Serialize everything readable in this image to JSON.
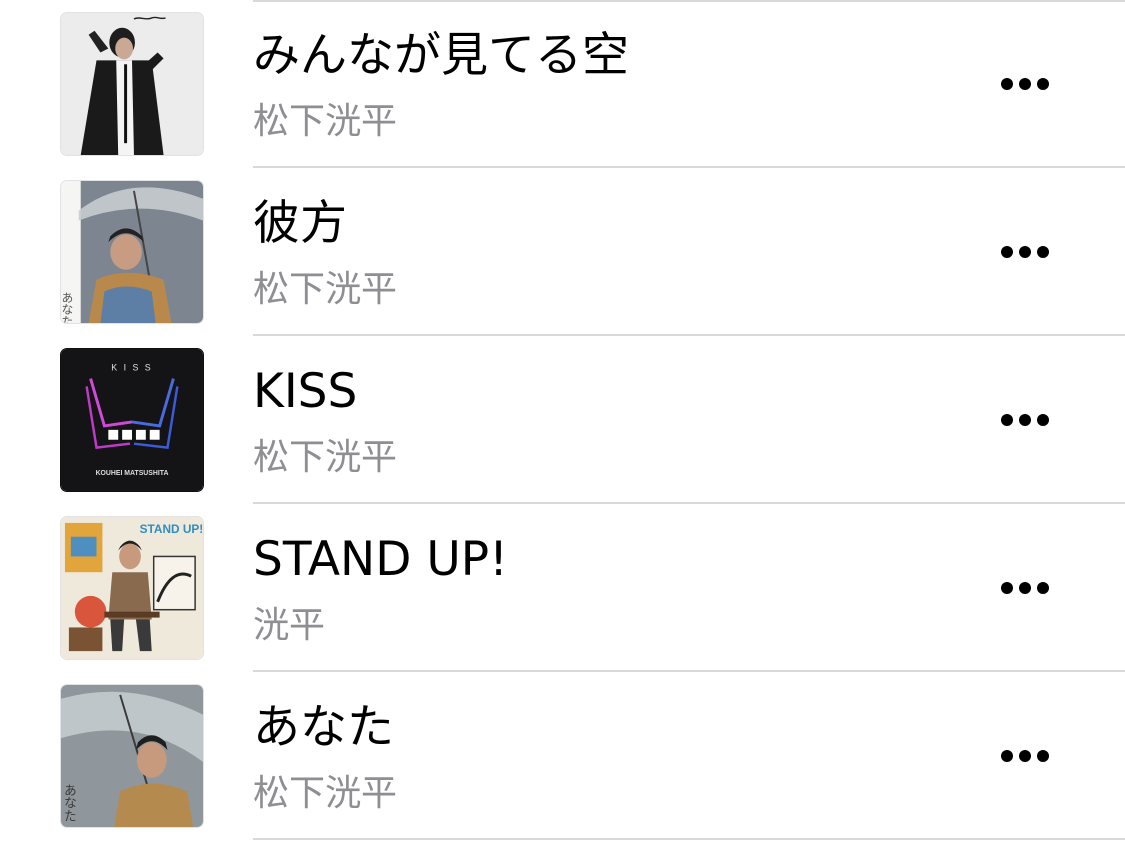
{
  "songs": [
    {
      "title": "みんなが見てる空",
      "artist": "松下洸平",
      "artwork": "album-art-monochrome-portrait"
    },
    {
      "title": "彼方",
      "artist": "松下洸平",
      "artwork": "album-art-umbrella-portrait"
    },
    {
      "title": "KISS",
      "artist": "松下洸平",
      "artwork": "album-art-neon-hands",
      "artwork_text": {
        "top": "K I S S",
        "bottom": "KOUHEI MATSUSHITA"
      }
    },
    {
      "title": "STAND UP!",
      "artist": "洸平",
      "artwork": "album-art-stand-up",
      "artwork_text": {
        "logo": "STAND UP!"
      }
    },
    {
      "title": "あなた",
      "artist": "松下洸平",
      "artwork": "album-art-umbrella-rain"
    }
  ],
  "more_icon": "ellipsis-icon",
  "colors": {
    "title": "#000000",
    "artist": "#8e8e93",
    "divider": "#d9d9dc",
    "background": "#ffffff"
  }
}
